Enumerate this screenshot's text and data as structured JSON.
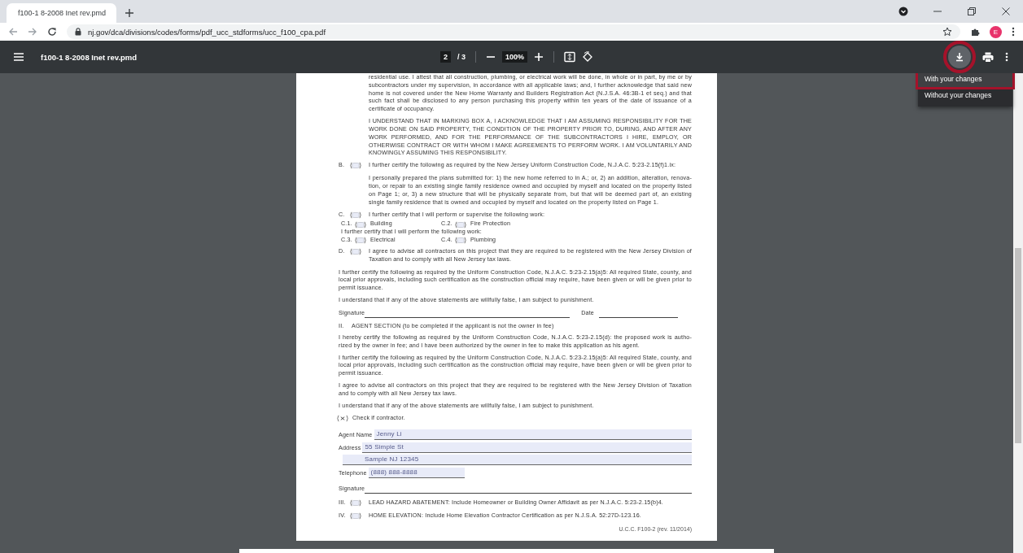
{
  "browser": {
    "tab": {
      "title": "f100-1 8-2008 Inet rev.pmd",
      "selected": true
    },
    "url": "nj.gov/dca/divisions/codes/forms/pdf_ucc_stdforms/ucc_f100_cpa.pdf",
    "profile_initial": "E"
  },
  "viewer": {
    "title": "f100-1 8-2008 Inet rev.pmd",
    "page": "2",
    "page_total": "/ 3",
    "zoom": "100%",
    "download_active": true,
    "download_menu": [
      {
        "label": "With your changes",
        "selected": true
      },
      {
        "label": "Without your changes",
        "selected": false
      }
    ]
  },
  "document": {
    "blocks": [
      {
        "kind": "para",
        "indent": true,
        "text": "residential use. I attest that all construction, plumbing, or electrical work will be done, in whole or in part, by me or by subcontractors under my supervision, in accordance with all applicable laws; and, I further acknowledge that said new home is not covered under the New Home Warranty and Builders Registration Act (N.J.S.A. 46:3B-1 et seq.) and that such fact shall be disclosed to any person purchasing this property within ten years of the date of issuance of a certificate of occupancy."
      },
      {
        "kind": "para",
        "indent": true,
        "text": "I UNDERSTAND THAT IN MARKING BOX A, I ACKNOWLEDGE THAT I AM ASSUMING RESPONSIBILITY FOR THE WORK DONE ON SAID PROPERTY, THE CONDITION OF THE PROPERTY PRIOR TO, DURING, AND AFTER ANY WORK PERFORMED, AND FOR THE PERFORMANCE OF THE SUBCONTRACTORS I HIRE, EMPLOY, OR OTHERWISE CONTRACT OR WITH WHOM I MAKE AGREEMENTS TO PERFORM WORK. I AM VOLUNTARILY AND KNOWINGLY ASSUMING THIS RESPONSIBILITY."
      },
      {
        "kind": "check",
        "label": "B.",
        "checked": false,
        "text": "I further certify the following as required by the New Jersey Uniform Construction Code, N.J.A.C. 5:23-2.15(f)1.ix:"
      },
      {
        "kind": "para",
        "indent": true,
        "text": "I personally prepared the plans submitted for: 1) the new home referred to in A.; or, 2) an addition, alteration, renova-tion, or repair to an existing single family residence owned and occupied by myself and located on the property listed on Page 1; or, 3) a new structure that will be physically separate from, but that will be deemed part of, an existing single family residence that is owned and occupied by myself and located on the property listed on Page 1."
      },
      {
        "kind": "check",
        "label": "C.",
        "checked": false,
        "text": "I further certify that I will perform or supervise the following work:"
      },
      {
        "kind": "options",
        "options": [
          {
            "label": "C.1.",
            "checked": false,
            "text": "Building"
          },
          {
            "label": "C.2.",
            "checked": false,
            "text": "Fire Protection"
          }
        ]
      },
      {
        "kind": "options",
        "title": "I further certify that I will perform the following work:",
        "options": [
          {
            "label": "C.3.",
            "checked": false,
            "text": "Electrical"
          },
          {
            "label": "C.4.",
            "checked": false,
            "text": "Plumbing"
          }
        ]
      },
      {
        "kind": "check",
        "label": "D.",
        "checked": false,
        "text": "I agree to advise all contractors on this project that they are required to be registered with the New Jersey Division of Taxation and to comply with all New Jersey tax laws."
      },
      {
        "kind": "para",
        "indent": false,
        "text": "I further certify the following as required by the Uniform Construction Code, N.J.A.C. 5:23-2.15(a)5: All required State, county, and local prior approvals, including such certification as the construction official may require, have been given or will be given prior to permit issuance."
      },
      {
        "kind": "para",
        "indent": false,
        "text": "I understand that if any of the above statements are willfully false, I am subject to punishment."
      },
      {
        "kind": "signature",
        "label": "Signature",
        "date_label": "Date"
      },
      {
        "kind": "heading",
        "number": "II.",
        "text": "AGENT SECTION (to be completed if the applicant is not the owner in fee)"
      },
      {
        "kind": "para",
        "indent": false,
        "text": "I hereby certify the following as required by the Uniform Construction Code, N.J.A.C. 5:23-2.15(d): the proposed work is autho-rized by the owner in fee; and I have been authorized by the owner in fee to make this application as his agent."
      },
      {
        "kind": "para",
        "indent": false,
        "text": "I further certify the following as required by the Uniform Construction Code, N.J.A.C. 5:23-2.15(a)5: All required State, county, and local prior approvals, including such certification as the construction official may require, have been given or will be given prior to permit issuance."
      },
      {
        "kind": "para",
        "indent": false,
        "text": "I agree to advise all contractors on this project that they are required to be registered with the New Jersey Division of Taxation and to comply with all New Jersey tax laws."
      },
      {
        "kind": "para",
        "indent": false,
        "text": "I understand that if any of the above statements are willfully false, I am subject to punishment."
      },
      {
        "kind": "mark",
        "checked": true,
        "text": "Check if contractor."
      },
      {
        "kind": "fields",
        "rows": [
          {
            "kind": "field",
            "label": "Agent Name",
            "value": "Jenny Li"
          },
          {
            "kind": "field",
            "label": "Address",
            "value": "55 Simple St"
          },
          {
            "kind": "continued",
            "value": "Sample NJ 12345"
          },
          {
            "kind": "short",
            "label": "Telephone",
            "value": "(888) 888-8888"
          },
          {
            "kind": "line",
            "label": "Signature"
          }
        ]
      },
      {
        "kind": "check",
        "label": "III.",
        "checked": false,
        "text": "LEAD HAZARD ABATEMENT: Include Homeowner or Building Owner Affidavit as per N.J.A.C. 5:23-2.15(b)4."
      },
      {
        "kind": "check",
        "label": "IV.",
        "checked": false,
        "text": "HOME ELEVATION: Include Home Elevation Contractor Certification as per N.J.S.A. 52:27D-123.16."
      },
      {
        "kind": "footer",
        "text": "U.C.C. F100-2 (rev. 11/2014)"
      }
    ]
  }
}
